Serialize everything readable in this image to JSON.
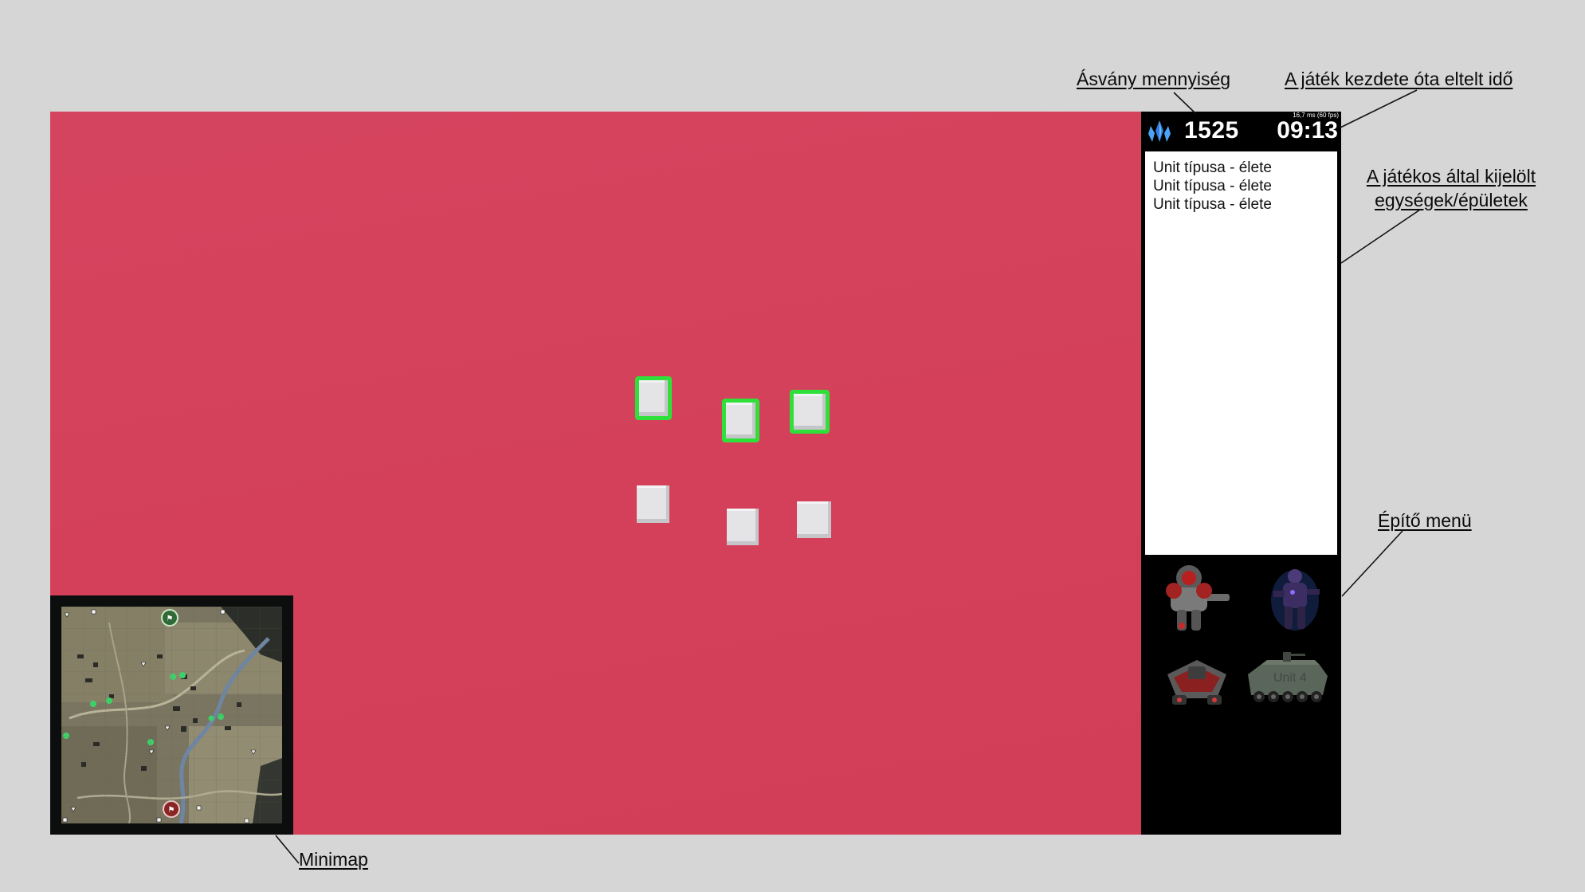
{
  "hud": {
    "minerals": "1525",
    "elapsed_time": "09:13",
    "fps_readout": "16,7 ms (60 fps)",
    "resource_icon": "crystal-icon"
  },
  "selection_panel": {
    "entries": [
      "Unit típusa - élete",
      "Unit típusa - élete",
      "Unit típusa - élete"
    ]
  },
  "build_menu": {
    "units": [
      {
        "icon": "marine-portrait-icon"
      },
      {
        "icon": "ghost-portrait-icon"
      },
      {
        "icon": "hover-tank-portrait-icon"
      },
      {
        "icon": "apc-portrait-icon",
        "label": "Unit 4"
      }
    ]
  },
  "annotations": {
    "minerals": "Ásvány mennyiség",
    "elapsed_time": "A játék kezdete óta eltelt idő",
    "selected_line1": "A játékos által kijelölt",
    "selected_line2": "egységek/épületek",
    "build_menu": "Építő menü",
    "minimap": "Minimap"
  },
  "world": {
    "units_total": 6,
    "units_selected": 3
  },
  "colors": {
    "viewport": "#d5425c",
    "selection_outline": "#2fe03a",
    "page_background": "#d6d6d6",
    "panel": "#000000"
  }
}
